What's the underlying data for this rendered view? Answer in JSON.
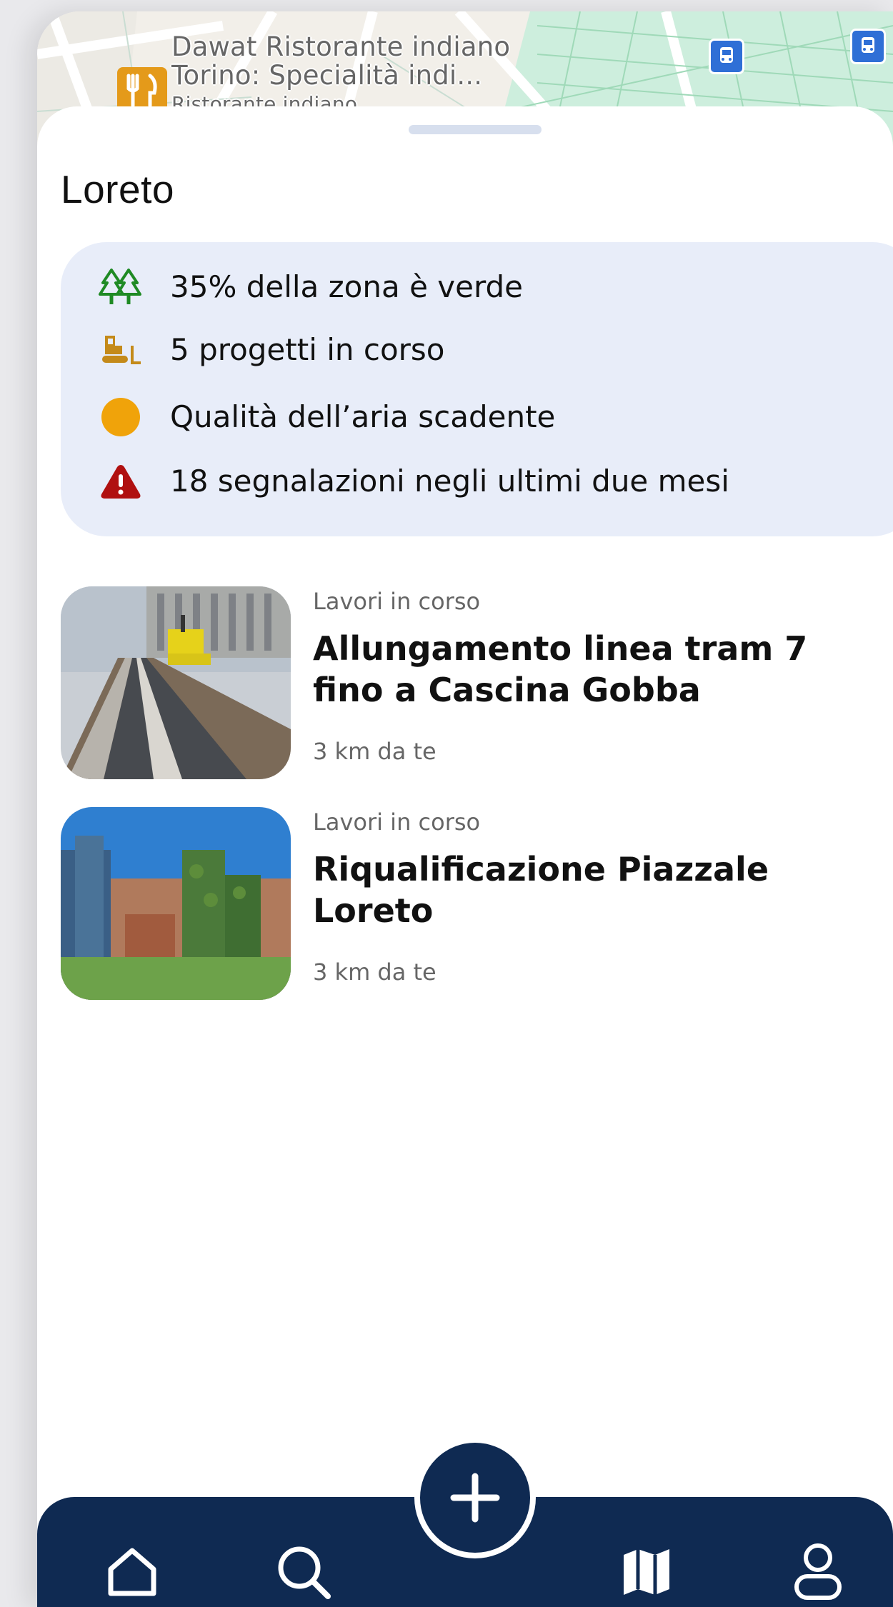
{
  "map": {
    "poi_lines": [
      "Dawat Ristorante indiano",
      "Torino: Specialità indi...",
      "Ristorante indiano"
    ]
  },
  "sheet": {
    "title": "Loreto",
    "stats": [
      {
        "icon": "trees-icon",
        "color": "#1f8a24",
        "text": "35% della zona è verde"
      },
      {
        "icon": "bulldozer-icon",
        "color": "#c48a1a",
        "text": "5 progetti in corso"
      },
      {
        "icon": "air-quality-dot-icon",
        "color": "#f0a30a",
        "text": "Qualità dell’aria scadente"
      },
      {
        "icon": "warning-triangle-icon",
        "color": "#b01010",
        "text": "18 segnalazioni negli ultimi due mesi"
      }
    ],
    "cards": [
      {
        "category": "Lavori in corso",
        "title": "Allungamento linea tram 7 fino a Cascina Gobba",
        "distance": "3 km da te"
      },
      {
        "category": "Lavori in corso",
        "title": "Riqualificazione Piazzale Loreto",
        "distance": "3 km da te"
      }
    ]
  },
  "nav": {
    "items": [
      "home-icon",
      "search-icon",
      "add-icon",
      "map-icon",
      "profile-icon"
    ],
    "background": "#0f2a52"
  }
}
